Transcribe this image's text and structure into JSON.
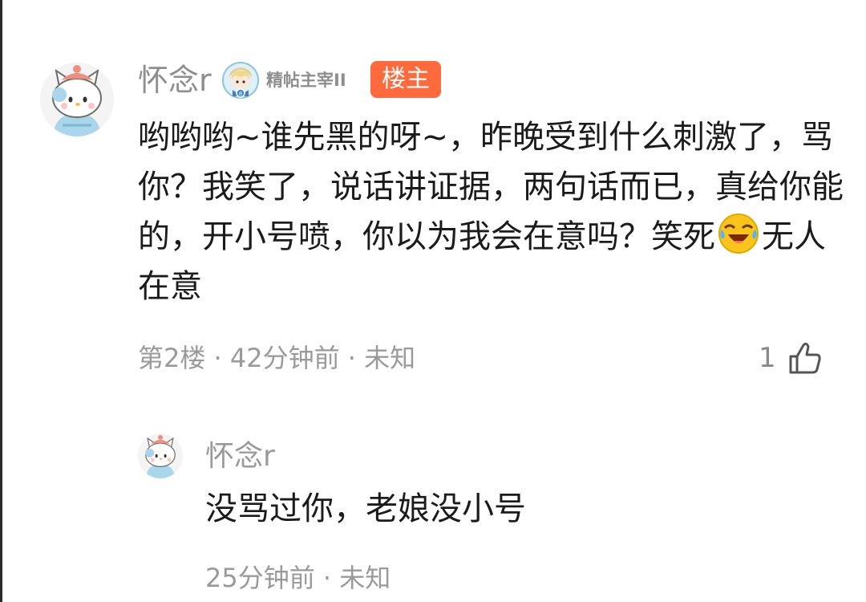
{
  "main_comment": {
    "username": "怀念r",
    "avatar_icon": "hello-kitty-avatar-icon",
    "badge_icon": "character-badge-icon",
    "badge_label": "精帖主宰II",
    "op_tag": "楼主",
    "text_before_emoji": "哟哟哟~谁先黑的呀~，昨晚受到什么刺激了，骂你？我笑了，说话讲证据，两句话而已，真给你能的，开小号喷，你以为我会在意吗？笑死",
    "emoji": "laughing-crying-icon",
    "text_after_emoji": "无人在意",
    "meta": "第2楼 · 42分钟前 · 未知",
    "like_count": "1",
    "like_icon": "thumbs-up-icon"
  },
  "reply": {
    "username": "怀念r",
    "avatar_icon": "hello-kitty-avatar-icon",
    "text": "没骂过你，老娘没小号",
    "meta": "25分钟前 · 未知"
  },
  "colors": {
    "op_tag_bg": "#ff6a3d",
    "meta_text": "#9a9a9a",
    "body_text": "#1b1b1b"
  }
}
